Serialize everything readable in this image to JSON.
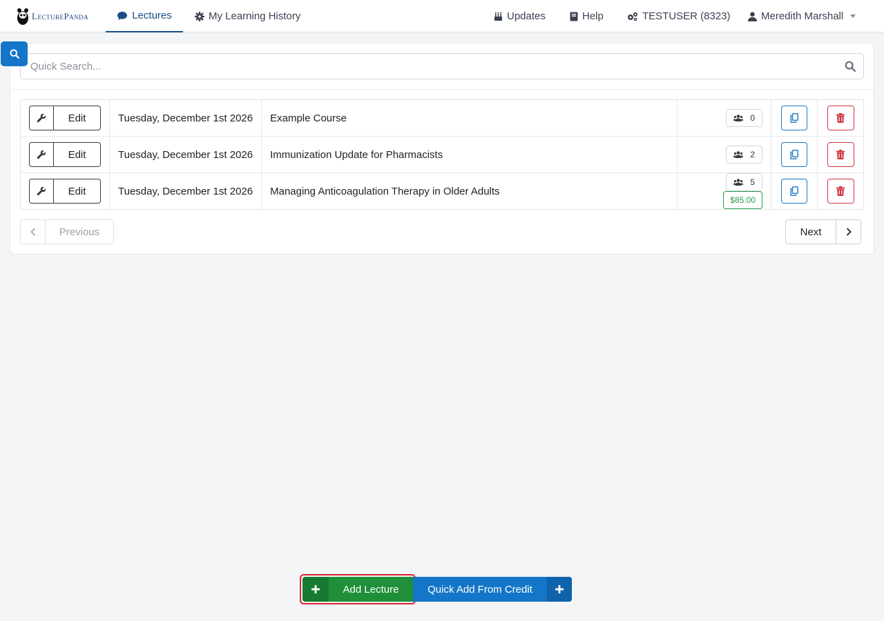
{
  "brand": {
    "name": "LecturePanda"
  },
  "nav": {
    "lectures": "Lectures",
    "history": "My Learning History",
    "updates": "Updates",
    "help": "Help",
    "account": "TESTUSER (8323)",
    "user": "Meredith Marshall"
  },
  "search": {
    "placeholder": "Quick Search..."
  },
  "lectures": [
    {
      "edit_label": "Edit",
      "date": "Tuesday, December 1st 2026",
      "title": "Example Course",
      "count": "0",
      "price": ""
    },
    {
      "edit_label": "Edit",
      "date": "Tuesday, December 1st 2026",
      "title": "Immunization Update for Pharmacists",
      "count": "2",
      "price": ""
    },
    {
      "edit_label": "Edit",
      "date": "Tuesday, December 1st 2026",
      "title": "Managing Anticoagulation Therapy in Older Adults",
      "count": "5",
      "price": "$85.00"
    }
  ],
  "pager": {
    "previous": "Previous",
    "next": "Next"
  },
  "actions": {
    "add_lecture": "Add Lecture",
    "quick_add": "Quick Add From Credit"
  },
  "colors": {
    "primary": "#1476c8",
    "success": "#1f8f3a",
    "danger": "#d0313f",
    "nav_active": "#1a4d8a"
  },
  "icons": {
    "brand": "panda-logo-icon",
    "lectures": "comment-icon",
    "history": "gear-icon",
    "updates": "updates-icon",
    "help": "book-icon",
    "account": "cogs-icon",
    "user": "user-icon",
    "edit": "wrench-icon",
    "count": "users-icon",
    "copy": "copy-icon",
    "delete": "trash-icon",
    "add": "plus-icon"
  }
}
